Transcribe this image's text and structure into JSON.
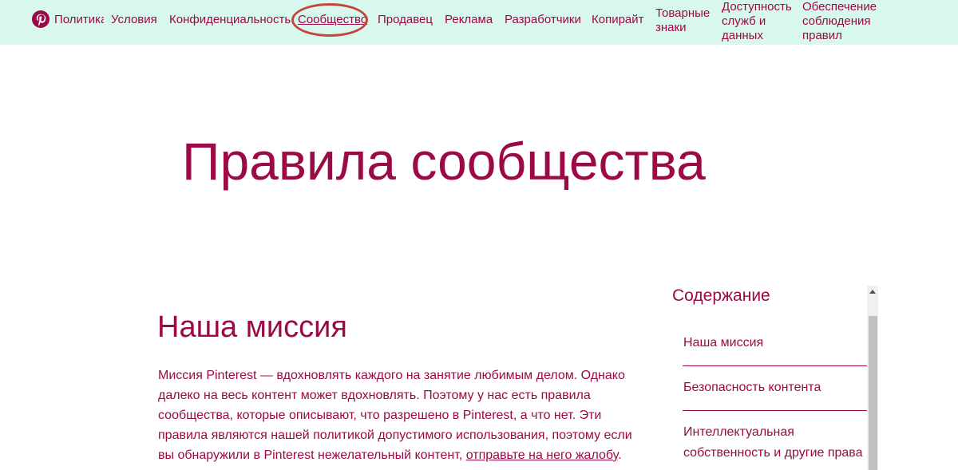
{
  "nav": {
    "items": [
      {
        "label": "Политика"
      },
      {
        "label": "Условия"
      },
      {
        "label": "Конфиденциальность"
      },
      {
        "label": "Сообщество"
      },
      {
        "label": "Продавец"
      },
      {
        "label": "Реклама"
      },
      {
        "label": "Разработчики"
      },
      {
        "label": "Копирайт"
      },
      {
        "label": "Товарные знаки"
      },
      {
        "label": "Доступность служб и данных"
      },
      {
        "label": "Обеспечение соблюдения правил"
      }
    ],
    "active": "Сообщество",
    "accent": "#9b0a46",
    "background": "#d8f8ee",
    "highlight_circle_color": "#c4463b"
  },
  "page": {
    "title": "Правила сообщества"
  },
  "main": {
    "heading": "Наша миссия",
    "paragraph_lines": [
      "Миссия Pinterest — вдохновлять каждого на занятие любимым делом. Однако",
      "далеко на весь контент может вдохновлять. Поэтому у нас есть правила",
      "сообщества, которые описывают, что разрешено в Pinterest, а что нет. Эти",
      "правила являются нашей политикой допустимого использования, поэтому если"
    ],
    "last_line_prefix": "вы обнаружили в Pinterest нежелательный контент, ",
    "report_link": "отправьте на него жалобу",
    "last_line_suffix": "."
  },
  "toc": {
    "heading": "Содержание",
    "items": [
      {
        "label": "Наша миссия"
      },
      {
        "label": "Безопасность контента"
      },
      {
        "label": "Интеллектуальная собственность и другие права"
      }
    ]
  }
}
